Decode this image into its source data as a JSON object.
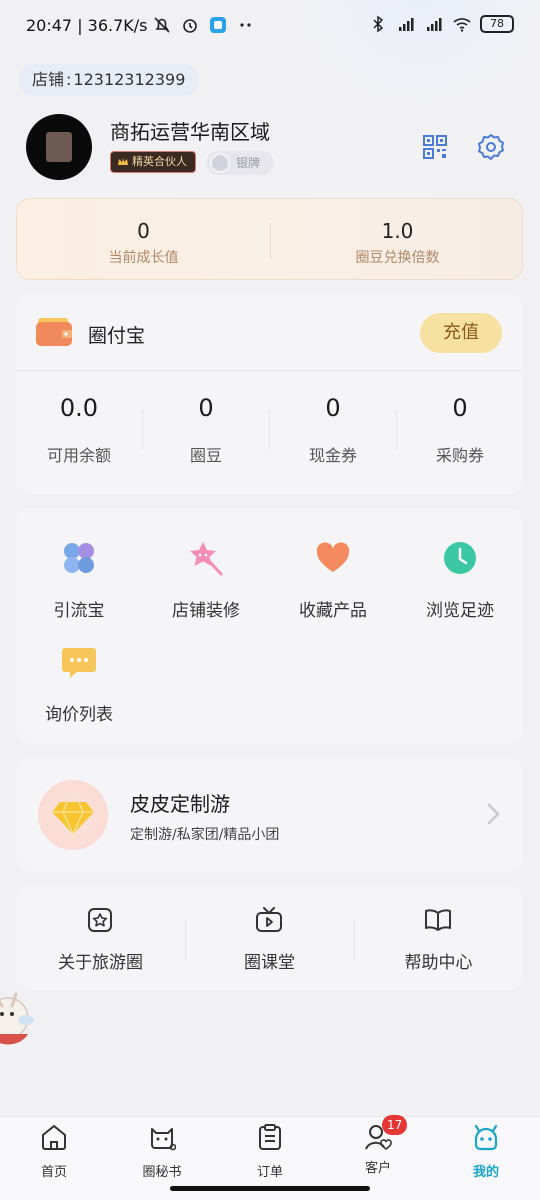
{
  "status_bar": {
    "time": "20:47",
    "speed": "36.7K/s",
    "battery": "78",
    "icons": [
      "mute-icon",
      "alarm-icon",
      "app-icon",
      "more-icon",
      "bluetooth-icon",
      "signal-icon",
      "signal-icon",
      "wifi-icon",
      "battery-icon"
    ]
  },
  "shop": {
    "label": "店铺",
    "separator": ":",
    "id": "12312312399"
  },
  "profile": {
    "name": "商拓运营华南区域",
    "badge_partner": "精英合伙人",
    "badge_level": "银牌",
    "icons": [
      "qr-code-icon",
      "settings-gear-icon"
    ]
  },
  "growth": {
    "items": [
      {
        "value": "0",
        "label": "当前成长值"
      },
      {
        "value": "1.0",
        "label": "圈豆兑换倍数"
      }
    ],
    "colors": {
      "label": "#b1896a",
      "bg": "#fbeee2"
    }
  },
  "wallet": {
    "title": "圈付宝",
    "recharge_label": "充值",
    "stats": [
      {
        "value": "0.0",
        "label": "可用余额"
      },
      {
        "value": "0",
        "label": "圈豆"
      },
      {
        "value": "0",
        "label": "现金券"
      },
      {
        "value": "0",
        "label": "采购券"
      }
    ],
    "colors": {
      "recharge_bg": "#f7e1a2",
      "recharge_text": "#8c5a1a"
    }
  },
  "functions": [
    {
      "label": "引流宝",
      "icon": "clover-icon"
    },
    {
      "label": "店铺装修",
      "icon": "star-wand-icon"
    },
    {
      "label": "收藏产品",
      "icon": "heart-icon"
    },
    {
      "label": "浏览足迹",
      "icon": "clock-icon"
    },
    {
      "label": "询价列表",
      "icon": "chat-bubble-icon"
    }
  ],
  "promo": {
    "title": "皮皮定制游",
    "subtitle": "定制游/私家团/精品小团",
    "icon": "diamond-icon"
  },
  "info": [
    {
      "label": "关于旅游圈",
      "icon": "star-badge-icon"
    },
    {
      "label": "圈课堂",
      "icon": "tv-play-icon"
    },
    {
      "label": "帮助中心",
      "icon": "open-book-icon"
    }
  ],
  "tabbar": {
    "items": [
      {
        "label": "首页",
        "icon": "home-icon"
      },
      {
        "label": "圈秘书",
        "icon": "cat-assistant-icon"
      },
      {
        "label": "订单",
        "icon": "clipboard-icon"
      },
      {
        "label": "客户",
        "icon": "customer-icon",
        "badge": "17"
      },
      {
        "label": "我的",
        "icon": "mascot-face-icon",
        "active": true
      }
    ],
    "active_color": "#1aa6c8"
  }
}
